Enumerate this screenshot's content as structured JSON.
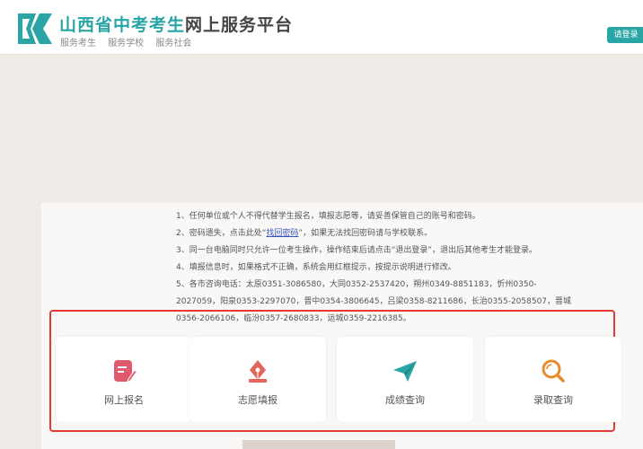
{
  "header": {
    "title_part1": "山西省中考考生",
    "title_part2": "网上服务平台",
    "subnav": [
      "服务考生",
      "服务学校",
      "服务社会"
    ],
    "login_label": "请登录",
    "logo_icon": "k-logo-icon",
    "accent_color": "#2aa5a5"
  },
  "notices": {
    "line1": "1、任何单位或个人不得代替学生报名，填报志愿等，请妥善保管自己的账号和密码。",
    "line2_pre": "2、密码遗失，点击此处“",
    "line2_link": "找回密码",
    "line2_post": "”，如果无法找回密码请与学校联系。",
    "line3": "3、同一台电脑同时只允许一位考生操作，操作结束后请点击“退出登录”，退出后其他考生才能登录。",
    "line4": "4、填报信息时，如果格式不正确，系统会用红框提示，按提示说明进行修改。",
    "line5": "5、各市咨询电话：太原0351-3086580，大同0352-2537420，朔州0349-8851183，忻州0350-",
    "line6": "2027059，阳泉0353-2297070，晋中0354-3806645，吕梁0358-8211686，长治0355-2058507，晋城",
    "line7": "0356-2066106，临汾0357-2680833，运城0359-2216385。"
  },
  "cards": [
    {
      "label": "网上报名",
      "icon": "edit-form-icon",
      "color": "#e05a6e"
    },
    {
      "label": "志愿填报",
      "icon": "pen-nib-icon",
      "color": "#e0675a"
    },
    {
      "label": "成绩查询",
      "icon": "paper-plane-icon",
      "color": "#2aa5a5"
    },
    {
      "label": "录取查询",
      "icon": "magnifier-icon",
      "color": "#e88a2e"
    }
  ]
}
